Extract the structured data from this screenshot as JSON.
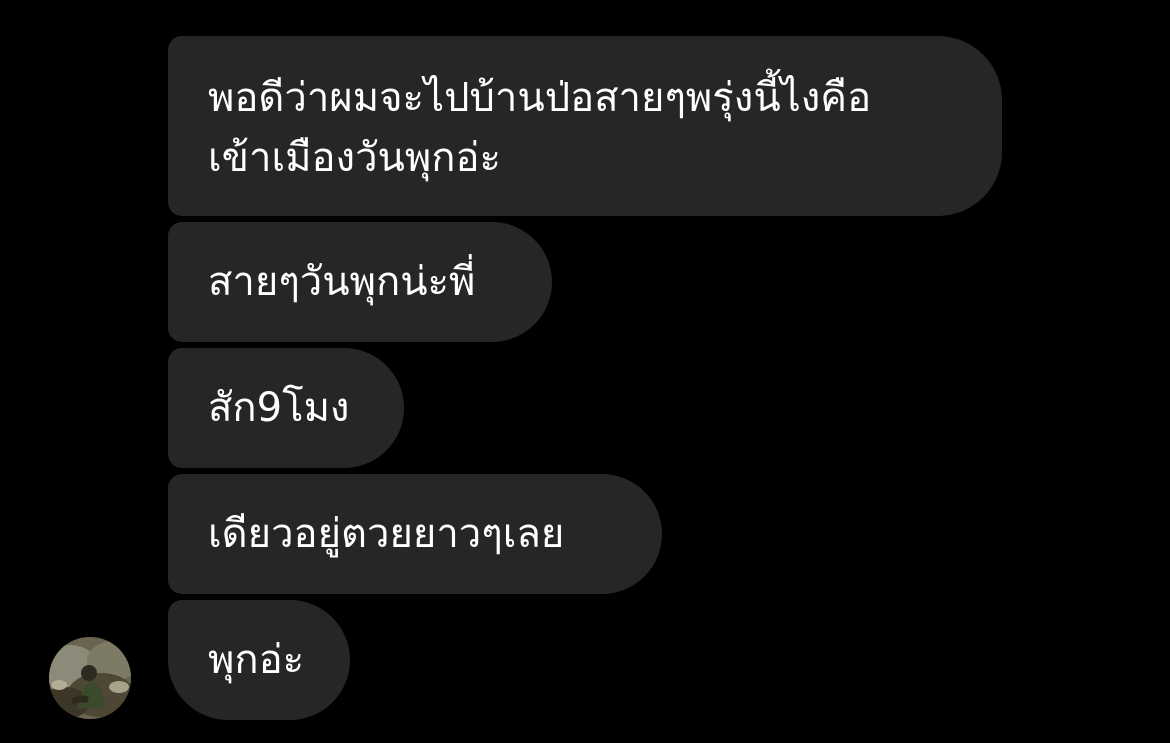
{
  "conversation": {
    "messages": [
      {
        "text": "พอดีว่าผมจะไปบ้านป่อสายๆพรุ่งนี้ไงคือ\nเข้าเมืองวันพุกอ่ะ"
      },
      {
        "text": "สายๆวันพุกน่ะพี่"
      },
      {
        "text": "สัก9โมง"
      },
      {
        "text": "เดียวอยู่ตวยยาวๆเลย"
      },
      {
        "text": "พุกอ่ะ"
      }
    ]
  },
  "colors": {
    "background": "#000000",
    "bubble": "#262626",
    "text": "#ffffff"
  },
  "icons": {
    "avatar": "sender-avatar-photo"
  }
}
